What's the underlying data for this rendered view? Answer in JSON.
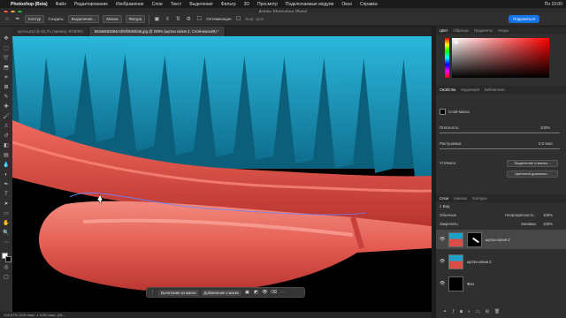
{
  "menubar": {
    "app": "Photoshop (Beta)",
    "items": [
      "Файл",
      "Редактирование",
      "Изображение",
      "Слои",
      "Текст",
      "Выделение",
      "Фильтр",
      "3D",
      "Просмотр",
      "Подключаемые модули",
      "Окно",
      "Справка"
    ],
    "clock": "Пн 10:00"
  },
  "window_title": "Adobe Photoshop (Beta)",
  "options": {
    "mode": "Контур",
    "make_label": "Создать:",
    "btn_selection": "Выделение...",
    "btn_mask": "Маска",
    "btn_shape": "Фигура",
    "optimize": "Оптимизация",
    "align_edges": "Выр. края",
    "share": "Поделиться"
  },
  "tabs": [
    {
      "label": "щетка.psd @ 66,7% (пример, RGB/8#)",
      "active": false
    },
    {
      "label": "562a5683384e1f64f3684b45.jpg @ 209% (щетка копия 3, Слой-маска/8) *",
      "active": true
    }
  ],
  "panels": {
    "color_tabs": [
      "Цвет",
      "Образцы",
      "Градиенты",
      "Узоры"
    ],
    "prop_tabs": [
      "Свойства",
      "Коррекция",
      "Библиотеки"
    ],
    "mask_label": "Слой-маска",
    "density_label": "Плотность:",
    "density_value": "100%",
    "feather_label": "Растушевка:",
    "feather_value": "0,0 пикс.",
    "refine_label": "Уточнить:",
    "btn_select_mask": "Выделение и маска...",
    "btn_color_range": "Цветовой диапазон...",
    "layer_tabs": [
      "Слои",
      "Каналы",
      "Контуры"
    ],
    "kind": "Вид",
    "blend": "Обычные",
    "opacity_label": "Непрозрачность:",
    "opacity_value": "100%",
    "lock_label": "Закрепить:",
    "fill_label": "Заливка:",
    "fill_value": "100%",
    "layers": [
      {
        "name": "щетка копия 3",
        "selected": true
      },
      {
        "name": "щетка копия 2",
        "selected": false
      },
      {
        "name": "Фон",
        "selected": false
      }
    ]
  },
  "context": {
    "subtract": "Вычитание из маски",
    "add": "Добавление к маске"
  },
  "status": "208,67%  1200 пикс. x 1200 пикс. (96..."
}
